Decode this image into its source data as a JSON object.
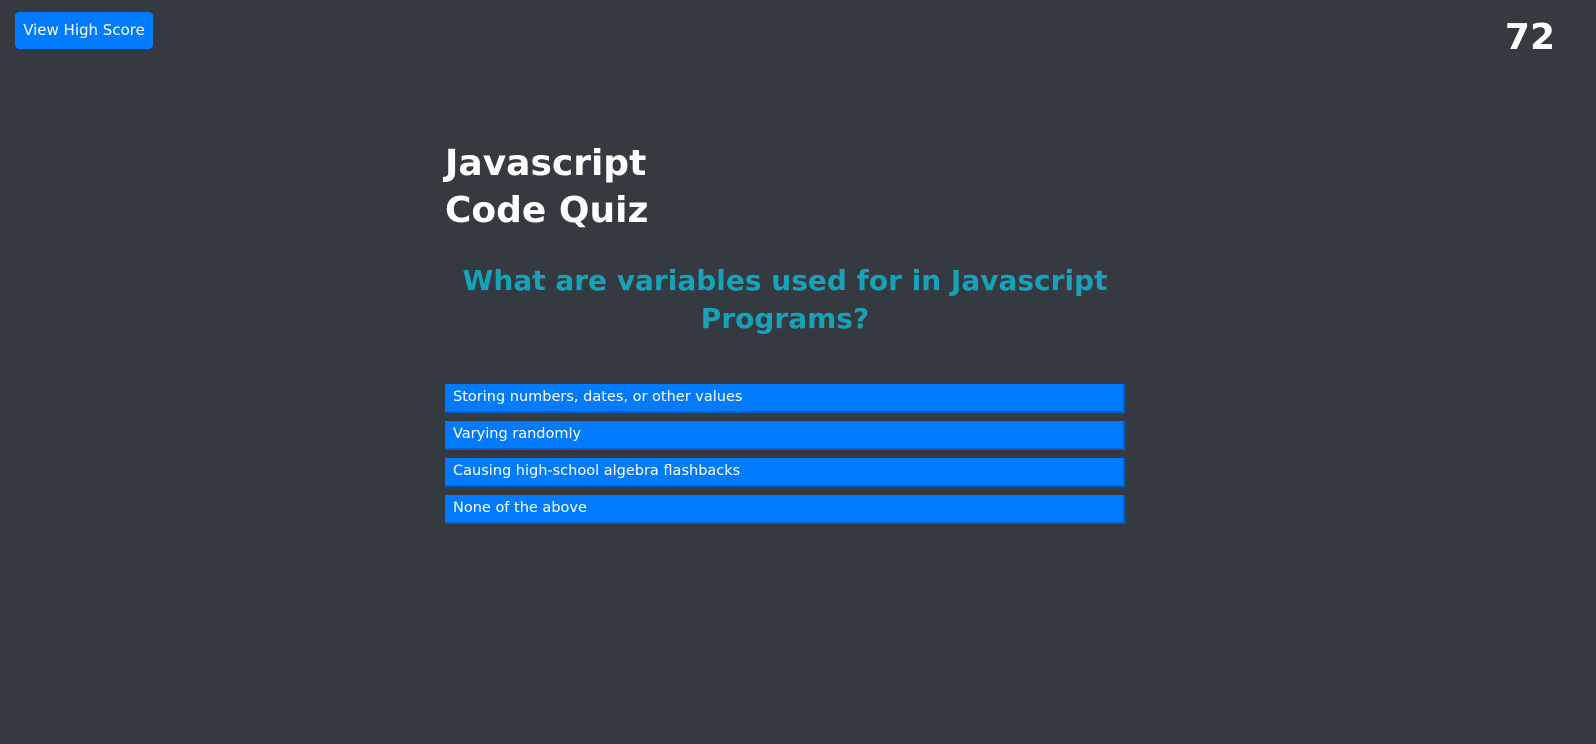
{
  "header": {
    "high_score_label": "View High Score",
    "timer_value": "72"
  },
  "quiz": {
    "title_line1": "Javascript",
    "title_line2": "Code Quiz",
    "question": "What are variables used for in Javascript Programs?",
    "answers": [
      {
        "label": "Storing numbers, dates, or other values"
      },
      {
        "label": "Varying randomly"
      },
      {
        "label": "Causing high-school algebra flashbacks"
      },
      {
        "label": "None of the above"
      }
    ]
  },
  "colors": {
    "background": "#343a40",
    "primary": "#007bff",
    "question_text": "#17a2b8",
    "text": "#ffffff"
  }
}
